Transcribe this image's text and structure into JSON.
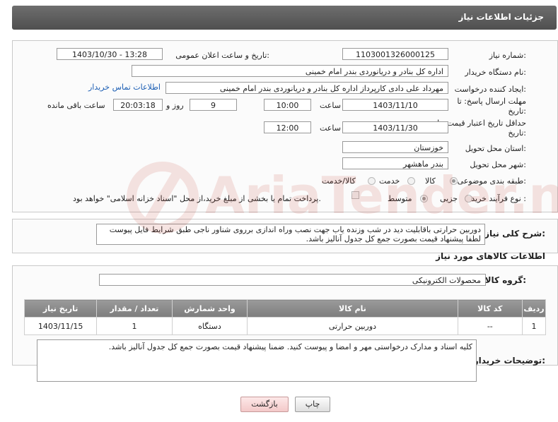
{
  "header": {
    "title": "جزئیات اطلاعات نیاز"
  },
  "form": {
    "need_number": {
      "label": "شماره نیاز:",
      "value": "1103001326000125"
    },
    "announce_datetime": {
      "label": "تاریخ و ساعت اعلان عمومی:",
      "value": "1403/10/30 - 13:28"
    },
    "buyer_org": {
      "label": "نام دستگاه خریدار:",
      "value": "اداره کل بنادر و دریانوردی بندر امام خمینی"
    },
    "requester": {
      "label": "ایجاد کننده درخواست:",
      "value": "مهرداد علی دادی کارپرداز اداره کل بنادر و دریانوردی بندر امام خمینی",
      "contact_link": "اطلاعات تماس خریدار"
    },
    "reply_deadline": {
      "label_line1": "مهلت ارسال پاسخ: تا",
      "label_line2": "تاریخ:",
      "date": "1403/11/10",
      "time_label": "ساعت",
      "time": "10:00",
      "days": "9",
      "days_label": "روز و",
      "remaining": "20:03:18",
      "remaining_label": "ساعت باقی مانده"
    },
    "price_validity": {
      "label_line1": "حداقل تاریخ اعتبار قیمت: تا",
      "label_line2": "تاریخ:",
      "date": "1403/11/30",
      "time_label": "ساعت",
      "time": "12:00"
    },
    "province": {
      "label": "استان محل تحویل:",
      "value": "خوزستان"
    },
    "city": {
      "label": "شهر محل تحویل:",
      "value": "بندر ماهشهر"
    },
    "subject_category": {
      "label": "طبقه بندی موضوعی:",
      "options": [
        "کالا",
        "خدمت",
        "کالا/خدمت"
      ],
      "selected": "کالا"
    },
    "purchase_type": {
      "label": "نوع فرآیند خرید :",
      "options": [
        "جزیی",
        "متوسط"
      ],
      "selected": "متوسط",
      "payment_note": "پرداخت تمام یا بخشی از مبلغ خرید،از محل \"اسناد خزانه اسلامی\" خواهد بود."
    }
  },
  "description": {
    "label": "شرح کلی نیاز:",
    "text": "دوربین حرارتی باقابلیت دید در شب وزنده یاب جهت نصب وراه اندازی برروی شناور ناجی طبق شرایط فایل پیوست لطفا پیشنهاد قیمت بصورت جمع کل جدول آنالیز باشد."
  },
  "goods": {
    "section_title": "اطلاعات کالاهای مورد نیاز",
    "group_label": "گروه کالا:",
    "group_value": "محصولات الکترونیکی",
    "columns": [
      "ردیف",
      "کد کالا",
      "نام کالا",
      "واحد شمارش",
      "تعداد / مقدار",
      "تاریخ نیاز"
    ],
    "rows": [
      {
        "row": "1",
        "code": "--",
        "name": "دوربین حرارتی",
        "unit": "دستگاه",
        "qty": "1",
        "date": "1403/11/15"
      }
    ]
  },
  "buyer_notes": {
    "label": "توضیحات خریدار:",
    "text": "کلیه اسناد و مدارک درخواستی مهر و امضا و پیوست کنید. ضمنا پیشنهاد قیمت بصورت جمع کل جدول آنالیز باشد."
  },
  "buttons": {
    "print": "چاپ",
    "back": "بازگشت"
  },
  "watermark": {
    "text": "AriaTender.neT"
  }
}
